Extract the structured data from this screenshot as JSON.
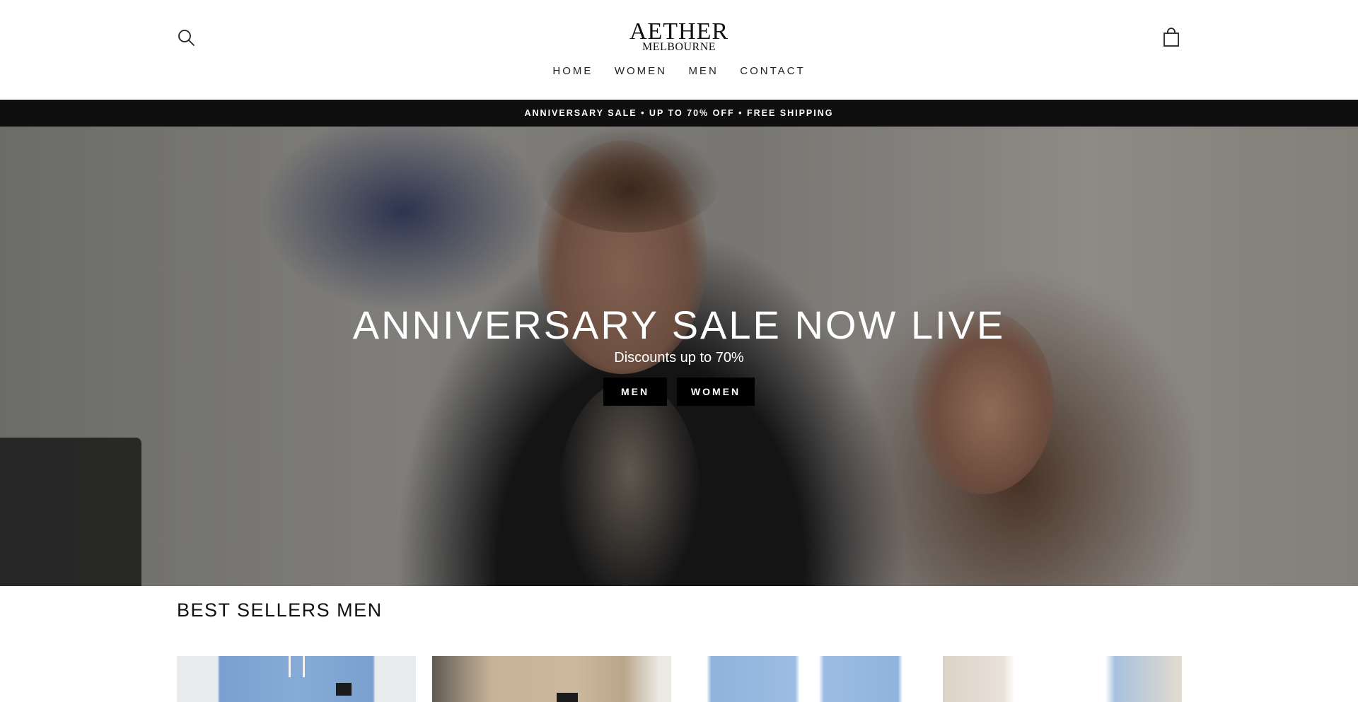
{
  "header": {
    "logo_main": "AETHER",
    "logo_sub": "MELBOURNE",
    "nav": [
      "HOME",
      "WOMEN",
      "MEN",
      "CONTACT"
    ],
    "icons": {
      "search": "search-icon",
      "cart": "shopping-bag-icon"
    }
  },
  "announcement": {
    "text": "ANNIVERSARY SALE • UP TO 70% OFF • FREE SHIPPING"
  },
  "hero": {
    "title": "ANNIVERSARY SALE NOW LIVE",
    "subtitle": "Discounts up to 70%",
    "buttons": [
      "MEN",
      "WOMEN"
    ]
  },
  "best_sellers": {
    "title": "BEST SELLERS MEN"
  },
  "colors": {
    "announcement_bg": "#0f0f0f",
    "button_bg": "#000000",
    "text": "#111111"
  }
}
